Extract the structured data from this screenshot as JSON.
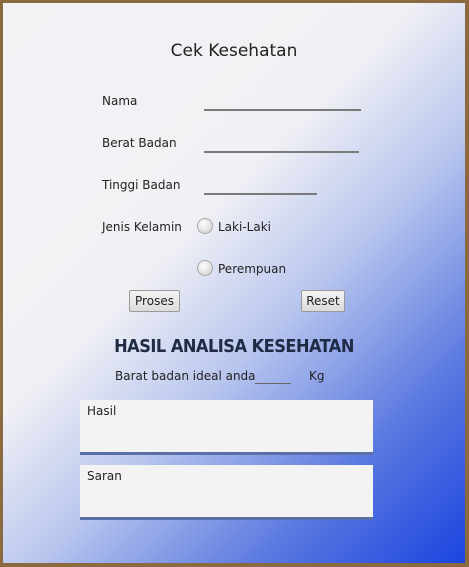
{
  "form": {
    "title": "Cek Kesehatan",
    "labels": {
      "nama": "Nama",
      "berat": "Berat Badan",
      "tinggi": "Tinggi Badan",
      "jenis": "Jenis Kelamin"
    },
    "gender_options": [
      "Laki-Laki",
      "Perempuan"
    ],
    "buttons": {
      "proses": "Proses",
      "reset": "Reset"
    }
  },
  "result": {
    "heading": "HASIL ANALISA KESEHATAN",
    "ideal_prefix": "Barat badan ideal anda",
    "ideal_value": "",
    "ideal_unit": "Kg",
    "hasil_label": "Hasil",
    "saran_label": "Saran"
  }
}
